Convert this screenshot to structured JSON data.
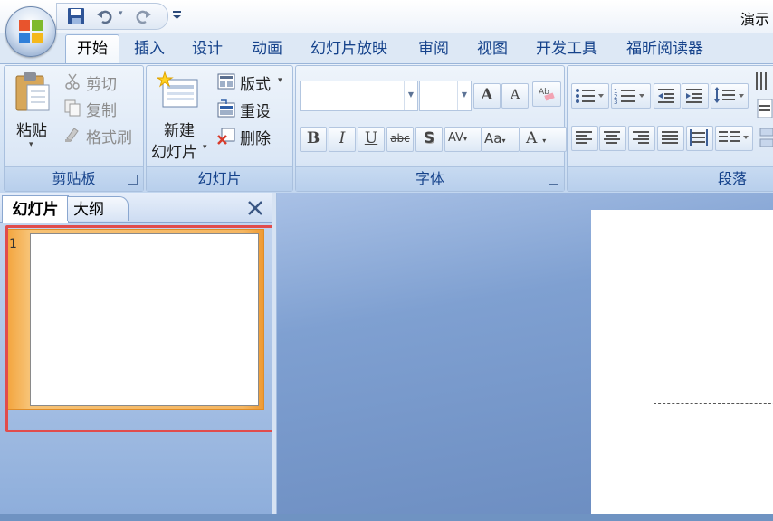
{
  "window": {
    "title": "演示"
  },
  "tabs": [
    {
      "label": "开始",
      "active": true
    },
    {
      "label": "插入"
    },
    {
      "label": "设计"
    },
    {
      "label": "动画"
    },
    {
      "label": "幻灯片放映"
    },
    {
      "label": "审阅"
    },
    {
      "label": "视图"
    },
    {
      "label": "开发工具"
    },
    {
      "label": "福昕阅读器"
    }
  ],
  "quick_access": {
    "icons": [
      "save-icon",
      "undo-icon",
      "redo-icon",
      "customize-icon"
    ]
  },
  "ribbon": {
    "clipboard": {
      "label": "剪贴板",
      "paste": "粘贴",
      "cut": "剪切",
      "copy": "复制",
      "format_painter": "格式刷"
    },
    "slides": {
      "label": "幻灯片",
      "new_slide_line1": "新建",
      "new_slide_line2": "幻灯片",
      "layout": "版式",
      "reset": "重设",
      "delete": "删除"
    },
    "font": {
      "label": "字体",
      "font_name": "",
      "font_size": "",
      "bold": "B",
      "italic": "I",
      "underline": "U",
      "strike": "abc",
      "shadow": "S",
      "spacing": "AV",
      "change_case": "Aa",
      "color": "A",
      "grow": "A",
      "shrink": "A"
    },
    "paragraph": {
      "label": "段落"
    }
  },
  "panel": {
    "tab_slides": "幻灯片",
    "tab_outline": "大纲",
    "slide_number": "1"
  },
  "colors": {
    "accent": "#15428b",
    "highlight": "#f5b661",
    "annotation": "#e14c4c"
  }
}
